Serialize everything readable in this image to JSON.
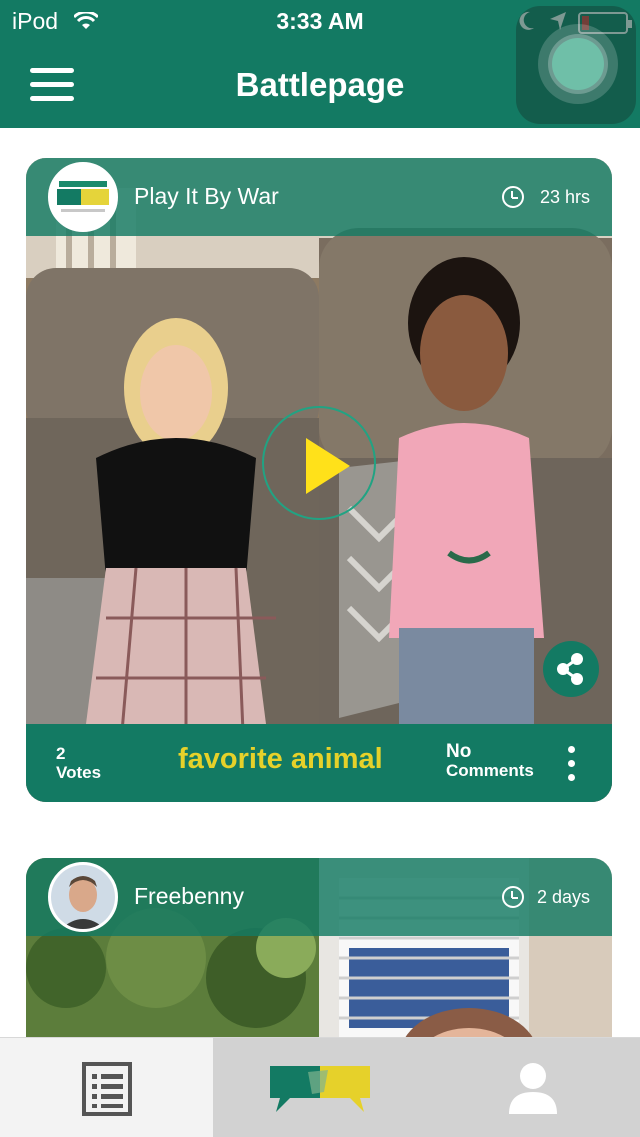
{
  "status_bar": {
    "carrier": "iPod",
    "time": "3:33 AM",
    "battery_color": "#e53935"
  },
  "header": {
    "title": "Battlepage",
    "menu_icon": "hamburger-menu-icon",
    "bg_color": "#137a63"
  },
  "battles": [
    {
      "username": "Play It By War",
      "avatar": "play-it-by-war-logo",
      "time_ago": "23 hrs",
      "votes_count": "2",
      "votes_label": "Votes",
      "topic": "favorite animal",
      "comments_count": "No",
      "comments_label": "Comments"
    },
    {
      "username": "Freebenny",
      "avatar": "user-photo-avatar",
      "time_ago": "2 days"
    }
  ],
  "colors": {
    "accent": "#137a63",
    "topic_yellow": "#e6d12a",
    "play_yellow": "#ffe11a"
  },
  "tabs": [
    {
      "name": "feed",
      "icon": "list-document-icon",
      "active": false
    },
    {
      "name": "battles",
      "icon": "battle-chat-logo-icon",
      "active": true
    },
    {
      "name": "profile",
      "icon": "profile-person-icon",
      "active": false
    }
  ]
}
